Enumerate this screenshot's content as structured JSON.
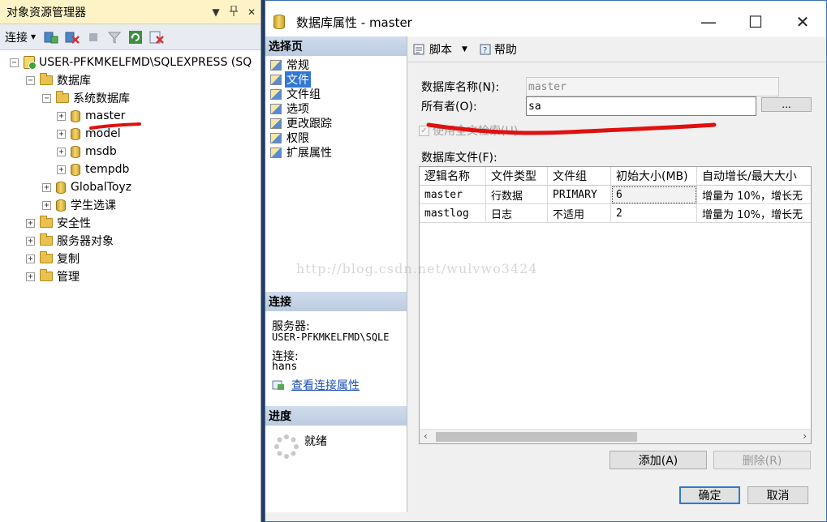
{
  "object_explorer": {
    "title": "对象资源管理器",
    "pin": "▾ ⊥ ✕",
    "connect_label": "连接",
    "tree": {
      "server": "USER-PFKMKELFMD\\SQLEXPRESS (SQ",
      "databases": "数据库",
      "system_databases": "系统数据库",
      "master": "master",
      "model": "model",
      "msdb": "msdb",
      "tempdb": "tempdb",
      "db1": "GlobalToyz",
      "db2": "学生选课",
      "security": "安全性",
      "server_objects": "服务器对象",
      "replication": "复制",
      "management": "管理"
    }
  },
  "dialog": {
    "title": "数据库属性 - master",
    "controls": {
      "minimize": "—",
      "maximize": "☐",
      "close": "✕"
    },
    "left": {
      "select_page_header": "选择页",
      "pages": [
        "常规",
        "文件",
        "文件组",
        "选项",
        "更改跟踪",
        "权限",
        "扩展属性"
      ],
      "connection_header": "连接",
      "server_label": "服务器:",
      "server_value": "USER-PFKMKELFMD\\SQLE",
      "conn_label": "连接:",
      "conn_value": "hans",
      "view_link": "查看连接属性",
      "progress_header": "进度",
      "progress_status": "就绪"
    },
    "toolbar": {
      "script": "脚本",
      "help": "帮助"
    },
    "db_name_label": "数据库名称(N):",
    "db_name_value": "master",
    "owner_label": "所有者(O):",
    "owner_value": "sa",
    "browse_label": "...",
    "fulltext_label": "使用全文检索(U)",
    "files_label": "数据库文件(F):",
    "grid": {
      "headers": [
        "逻辑名称",
        "文件类型",
        "文件组",
        "初始大小(MB)",
        "自动增长/最大大小"
      ],
      "rows": [
        [
          "master",
          "行数据",
          "PRIMARY",
          "6",
          "增量为 10%，增长无"
        ],
        [
          "mastlog",
          "日志",
          "不适用",
          "2",
          "增量为 10%，增长无"
        ]
      ]
    },
    "add_button": "添加(A)",
    "remove_button": "删除(R)",
    "ok_button": "确定",
    "cancel_button": "取消"
  },
  "watermark": "http://blog.csdn.net/wulvwo3424"
}
